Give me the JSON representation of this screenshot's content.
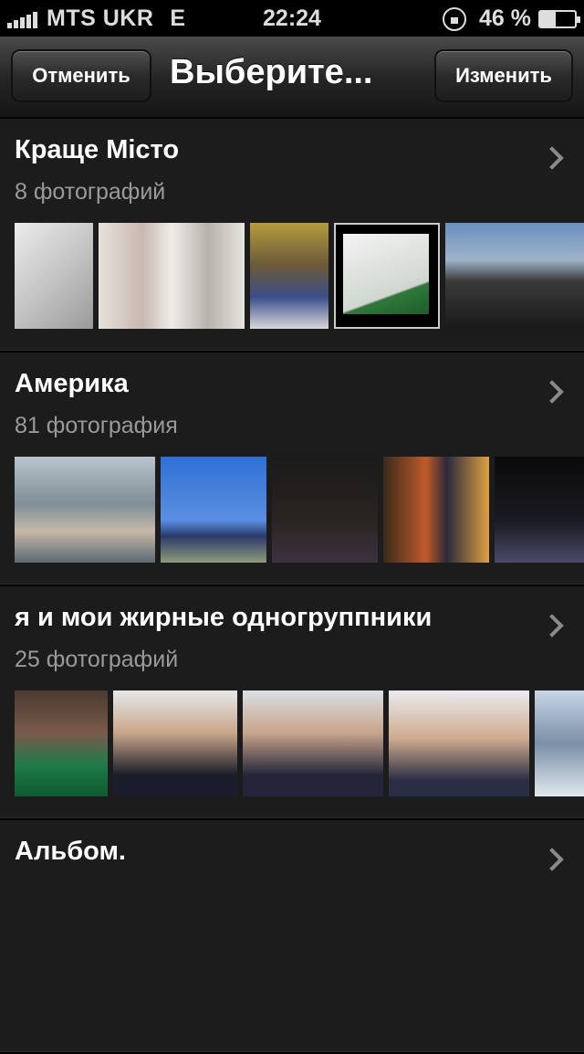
{
  "status_bar": {
    "carrier": "MTS UKR",
    "network": "E",
    "time": "22:24",
    "battery_percent": "46 %",
    "battery_level": 0.46
  },
  "nav": {
    "cancel_label": "Отменить",
    "title": "Выберите...",
    "edit_label": "Изменить"
  },
  "albums": [
    {
      "title": "Краще Місто",
      "count": "8 фотографий"
    },
    {
      "title": "Америка",
      "count": "81 фотография"
    },
    {
      "title": "я и мои жирные одногруппники",
      "count": "25 фотографий"
    },
    {
      "title": "Альбом.",
      "count": ""
    }
  ]
}
